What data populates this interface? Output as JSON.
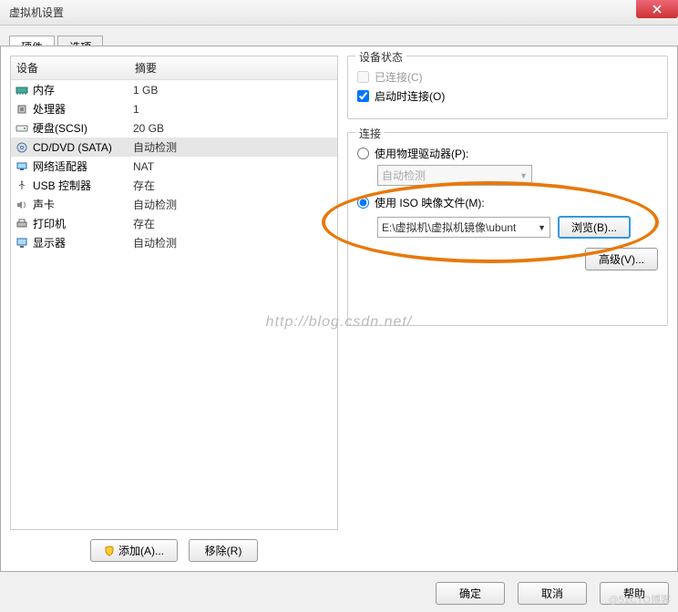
{
  "title": "虚拟机设置",
  "tabs": {
    "hardware": "硬件",
    "options": "选项"
  },
  "list": {
    "col_device": "设备",
    "col_summary": "摘要",
    "rows": [
      {
        "icon": "memory-icon",
        "device": "内存",
        "summary": "1 GB"
      },
      {
        "icon": "cpu-icon",
        "device": "处理器",
        "summary": "1"
      },
      {
        "icon": "hdd-icon",
        "device": "硬盘(SCSI)",
        "summary": "20 GB"
      },
      {
        "icon": "cd-icon",
        "device": "CD/DVD (SATA)",
        "summary": "自动检测"
      },
      {
        "icon": "net-icon",
        "device": "网络适配器",
        "summary": "NAT"
      },
      {
        "icon": "usb-icon",
        "device": "USB 控制器",
        "summary": "存在"
      },
      {
        "icon": "sound-icon",
        "device": "声卡",
        "summary": "自动检测"
      },
      {
        "icon": "printer-icon",
        "device": "打印机",
        "summary": "存在"
      },
      {
        "icon": "display-icon",
        "device": "显示器",
        "summary": "自动检测"
      }
    ]
  },
  "left_buttons": {
    "add": "添加(A)...",
    "remove": "移除(R)"
  },
  "status_group": {
    "title": "设备状态",
    "connected": "已连接(C)",
    "connect_at_power": "启动时连接(O)"
  },
  "conn_group": {
    "title": "连接",
    "use_physical": "使用物理驱动器(P):",
    "physical_value": "自动检测",
    "use_iso": "使用 ISO 映像文件(M):",
    "iso_path": "E:\\虚拟机\\虚拟机镜像\\ubunt",
    "browse": "浏览(B)...",
    "advanced": "高级(V)..."
  },
  "footer": {
    "ok": "确定",
    "cancel": "取消",
    "help": "帮助"
  },
  "watermark": "http://blog.csdn.net/",
  "watermark2": "@51CTO博客"
}
